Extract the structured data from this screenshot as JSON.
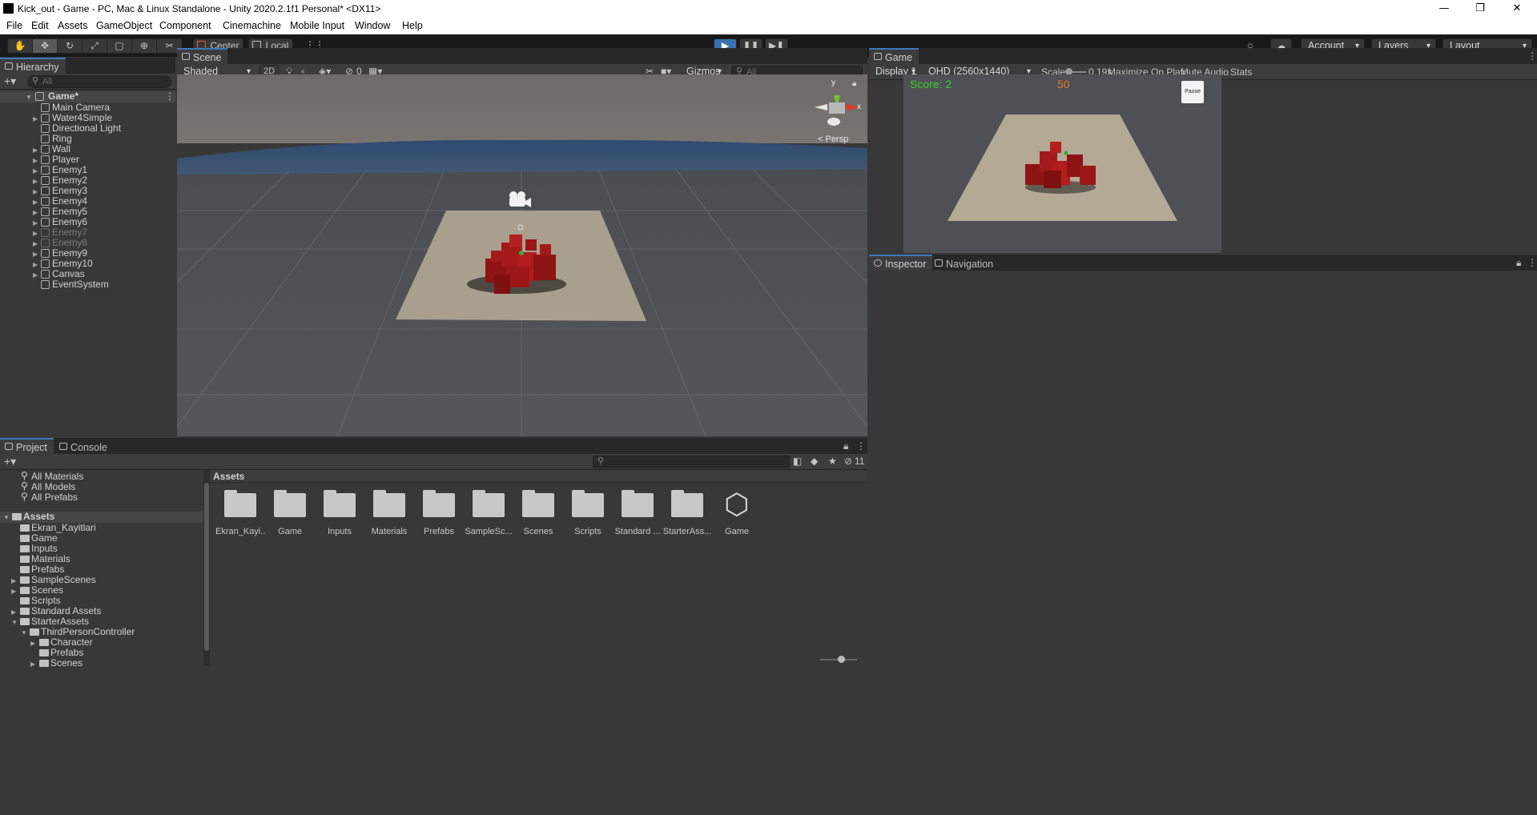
{
  "window": {
    "title": "Kick_out - Game - PC, Mac & Linux Standalone - Unity 2020.2.1f1 Personal* <DX11>",
    "controls": [
      "—",
      "❐",
      "✕"
    ]
  },
  "menu": [
    "File",
    "Edit",
    "Assets",
    "GameObject",
    "Component",
    "Cinemachine",
    "Mobile Input",
    "Window",
    "Help"
  ],
  "toolbar": {
    "pivot": "Center",
    "space": "Local",
    "account": "Account",
    "layers": "Layers",
    "layout": "Layout"
  },
  "hierarchy": {
    "tab": "Hierarchy",
    "search_placeholder": "All",
    "root": "Game*",
    "items": [
      {
        "label": "Main Camera",
        "expandable": false,
        "dim": false
      },
      {
        "label": "Water4Simple",
        "expandable": true,
        "dim": false
      },
      {
        "label": "Directional Light",
        "expandable": false,
        "dim": false
      },
      {
        "label": "Ring",
        "expandable": false,
        "dim": false
      },
      {
        "label": "Wall",
        "expandable": true,
        "dim": false
      },
      {
        "label": "Player",
        "expandable": true,
        "dim": false
      },
      {
        "label": "Enemy1",
        "expandable": true,
        "dim": false
      },
      {
        "label": "Enemy2",
        "expandable": true,
        "dim": false
      },
      {
        "label": "Enemy3",
        "expandable": true,
        "dim": false
      },
      {
        "label": "Enemy4",
        "expandable": true,
        "dim": false
      },
      {
        "label": "Enemy5",
        "expandable": true,
        "dim": false
      },
      {
        "label": "Enemy6",
        "expandable": true,
        "dim": false
      },
      {
        "label": "Enemy7",
        "expandable": true,
        "dim": true
      },
      {
        "label": "Enemy8",
        "expandable": true,
        "dim": true
      },
      {
        "label": "Enemy9",
        "expandable": true,
        "dim": false
      },
      {
        "label": "Enemy10",
        "expandable": true,
        "dim": false
      },
      {
        "label": "Canvas",
        "expandable": true,
        "dim": false
      },
      {
        "label": "EventSystem",
        "expandable": false,
        "dim": false
      }
    ]
  },
  "scene": {
    "tab": "Scene",
    "shading": "Shaded",
    "mode_2d": "2D",
    "hidden_count": "0",
    "gizmos": "Gizmos",
    "search_placeholder": "All",
    "axis_y": "y",
    "axis_x": "x",
    "projection": "< Persp"
  },
  "game": {
    "tab": "Game",
    "display": "Display 1",
    "resolution": "QHD (2560x1440)",
    "scale_label": "Scale",
    "scale_value": "0.19x",
    "maximize": "Maximize On Play",
    "mute": "Mute Audio",
    "stats": "Stats",
    "hud_score": "Score: 2",
    "hud_timer": "50",
    "hud_pause": "Pause"
  },
  "inspector": {
    "tab_inspector": "Inspector",
    "tab_navigation": "Navigation"
  },
  "project": {
    "tab_project": "Project",
    "tab_console": "Console",
    "hidden_packages": "11",
    "favorites": [
      "All Materials",
      "All Models",
      "All Prefabs"
    ],
    "tree_root": "Assets",
    "tree": [
      {
        "label": "Ekran_Kayitlari",
        "depth": 1,
        "fold": ""
      },
      {
        "label": "Game",
        "depth": 1,
        "fold": ""
      },
      {
        "label": "Inputs",
        "depth": 1,
        "fold": ""
      },
      {
        "label": "Materials",
        "depth": 1,
        "fold": ""
      },
      {
        "label": "Prefabs",
        "depth": 1,
        "fold": ""
      },
      {
        "label": "SampleScenes",
        "depth": 1,
        "fold": "▶"
      },
      {
        "label": "Scenes",
        "depth": 1,
        "fold": "▶"
      },
      {
        "label": "Scripts",
        "depth": 1,
        "fold": ""
      },
      {
        "label": "Standard Assets",
        "depth": 1,
        "fold": "▶"
      },
      {
        "label": "StarterAssets",
        "depth": 1,
        "fold": "▼"
      },
      {
        "label": "ThirdPersonController",
        "depth": 2,
        "fold": "▼"
      },
      {
        "label": "Character",
        "depth": 3,
        "fold": "▶"
      },
      {
        "label": "Prefabs",
        "depth": 3,
        "fold": ""
      },
      {
        "label": "Scenes",
        "depth": 3,
        "fold": "▶"
      }
    ],
    "breadcrumb": "Assets",
    "assets": [
      {
        "label": "Ekran_Kayi...",
        "kind": "folder"
      },
      {
        "label": "Game",
        "kind": "folder"
      },
      {
        "label": "Inputs",
        "kind": "folder"
      },
      {
        "label": "Materials",
        "kind": "folder"
      },
      {
        "label": "Prefabs",
        "kind": "folder"
      },
      {
        "label": "SampleSc...",
        "kind": "folder"
      },
      {
        "label": "Scenes",
        "kind": "folder"
      },
      {
        "label": "Scripts",
        "kind": "folder"
      },
      {
        "label": "Standard ...",
        "kind": "folder"
      },
      {
        "label": "StarterAss...",
        "kind": "folder"
      },
      {
        "label": "Game",
        "kind": "unity-scene"
      }
    ]
  },
  "colors": {
    "accent_blue": "#3a79bb",
    "hud_score": "#3cd22a",
    "hud_timer": "#e07a2a",
    "enemy_red": "#a01818"
  }
}
